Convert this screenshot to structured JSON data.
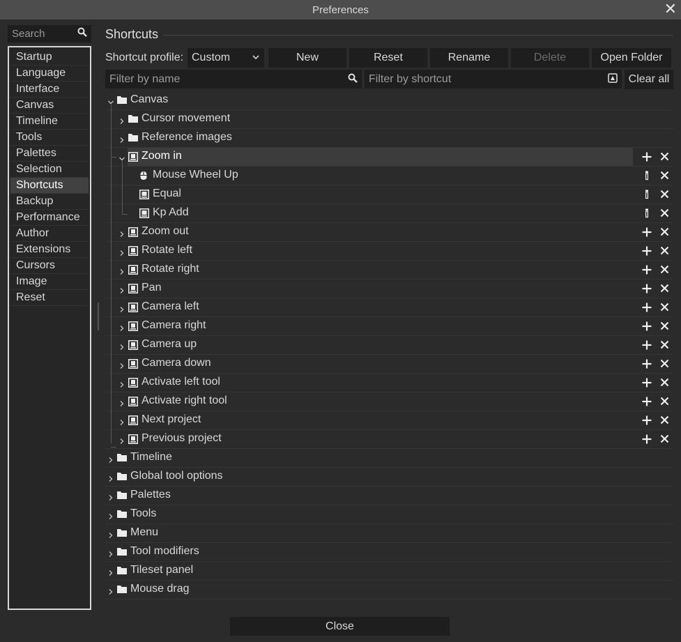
{
  "window": {
    "title": "Preferences"
  },
  "sidebar": {
    "search_placeholder": "Search",
    "items": [
      {
        "label": "Startup"
      },
      {
        "label": "Language"
      },
      {
        "label": "Interface"
      },
      {
        "label": "Canvas"
      },
      {
        "label": "Timeline"
      },
      {
        "label": "Tools"
      },
      {
        "label": "Palettes"
      },
      {
        "label": "Selection"
      },
      {
        "label": "Shortcuts",
        "selected": true
      },
      {
        "label": "Backup"
      },
      {
        "label": "Performance"
      },
      {
        "label": "Author"
      },
      {
        "label": "Extensions"
      },
      {
        "label": "Cursors"
      },
      {
        "label": "Image"
      },
      {
        "label": "Reset"
      }
    ]
  },
  "main": {
    "title": "Shortcuts",
    "profile_label": "Shortcut profile:",
    "profile_value": "Custom",
    "buttons": {
      "new": "New",
      "reset": "Reset",
      "rename": "Rename",
      "delete": "Delete",
      "open_folder": "Open Folder"
    },
    "filter_name_placeholder": "Filter by name",
    "filter_shortcut_placeholder": "Filter by shortcut",
    "clear_all": "Clear all"
  },
  "tree": [
    {
      "label": "Canvas",
      "level": 0,
      "type": "folder",
      "expanded": true
    },
    {
      "label": "Cursor movement",
      "level": 1,
      "type": "folder",
      "expanded": false
    },
    {
      "label": "Reference images",
      "level": 1,
      "type": "folder",
      "expanded": false
    },
    {
      "label": "Zoom in",
      "level": 1,
      "type": "action",
      "expanded": true,
      "selected": true
    },
    {
      "label": "Mouse Wheel Up",
      "level": 2,
      "type": "mouse-event"
    },
    {
      "label": "Equal",
      "level": 2,
      "type": "key-event"
    },
    {
      "label": "Kp Add",
      "level": 2,
      "type": "key-event"
    },
    {
      "label": "Zoom out",
      "level": 1,
      "type": "action",
      "expanded": false
    },
    {
      "label": "Rotate left",
      "level": 1,
      "type": "action",
      "expanded": false
    },
    {
      "label": "Rotate right",
      "level": 1,
      "type": "action",
      "expanded": false
    },
    {
      "label": "Pan",
      "level": 1,
      "type": "action",
      "expanded": false
    },
    {
      "label": "Camera left",
      "level": 1,
      "type": "action",
      "expanded": false
    },
    {
      "label": "Camera right",
      "level": 1,
      "type": "action",
      "expanded": false
    },
    {
      "label": "Camera up",
      "level": 1,
      "type": "action",
      "expanded": false
    },
    {
      "label": "Camera down",
      "level": 1,
      "type": "action",
      "expanded": false
    },
    {
      "label": "Activate left tool",
      "level": 1,
      "type": "action",
      "expanded": false
    },
    {
      "label": "Activate right tool",
      "level": 1,
      "type": "action",
      "expanded": false
    },
    {
      "label": "Next project",
      "level": 1,
      "type": "action",
      "expanded": false
    },
    {
      "label": "Previous project",
      "level": 1,
      "type": "action",
      "expanded": false
    },
    {
      "label": "Timeline",
      "level": 0,
      "type": "folder",
      "expanded": false
    },
    {
      "label": "Global tool options",
      "level": 0,
      "type": "folder",
      "expanded": false
    },
    {
      "label": "Palettes",
      "level": 0,
      "type": "folder",
      "expanded": false
    },
    {
      "label": "Tools",
      "level": 0,
      "type": "folder",
      "expanded": false
    },
    {
      "label": "Menu",
      "level": 0,
      "type": "folder",
      "expanded": false
    },
    {
      "label": "Tool modifiers",
      "level": 0,
      "type": "folder",
      "expanded": false
    },
    {
      "label": "Tileset panel",
      "level": 0,
      "type": "folder",
      "expanded": false
    },
    {
      "label": "Mouse drag",
      "level": 0,
      "type": "folder",
      "expanded": false
    }
  ],
  "footer": {
    "close_label": "Close"
  },
  "colors": {
    "bg": "#2b2b2b",
    "field": "#1e1e1e",
    "titlebar": "#4d4d4d",
    "selected": "#3c3c3c"
  }
}
